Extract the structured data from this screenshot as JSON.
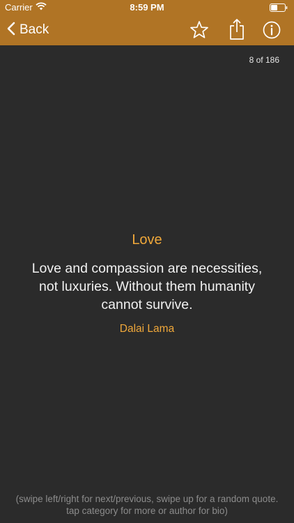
{
  "status_bar": {
    "carrier": "Carrier",
    "time": "8:59 PM",
    "wifi_icon": "wifi-icon",
    "battery_icon": "battery-icon"
  },
  "nav": {
    "back_label": "Back",
    "back_icon": "chevron-left-icon",
    "favorite_icon": "star-icon",
    "share_icon": "share-icon",
    "info_icon": "info-icon"
  },
  "counter": "8 of 186",
  "quote": {
    "category": "Love",
    "text": "Love and compassion are necessities, not luxuries. Without them humanity cannot survive.",
    "author": "Dalai Lama"
  },
  "hint": "(swipe left/right for next/previous, swipe up for a random quote. tap category for more or author for bio)",
  "colors": {
    "bar": "#b07425",
    "background": "#2b2b2b",
    "accent": "#f0a83a",
    "text": "#f1f1f1",
    "hint": "#8c8c8c"
  }
}
